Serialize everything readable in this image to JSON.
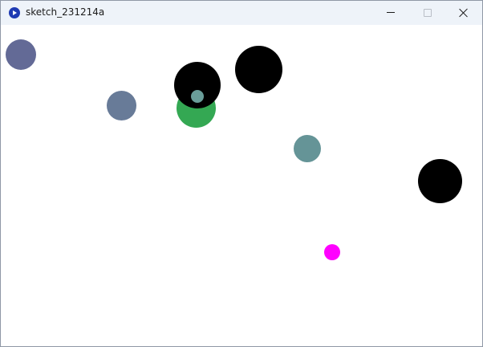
{
  "window": {
    "title": "sketch_231214a",
    "icon": "processing-app-icon"
  },
  "caption_buttons": {
    "minimize_icon": "minimize-icon",
    "maximize_icon": "maximize-icon",
    "close_icon": "close-icon"
  },
  "canvas": {
    "background": "#ffffff",
    "circle_colors": {
      "purple": "#636a96",
      "slate": "#687b98",
      "green": "#34a853",
      "black": "#000000",
      "teal_small": "#6a9e9a",
      "teal": "#659497",
      "magenta": "#ff00ff"
    }
  }
}
